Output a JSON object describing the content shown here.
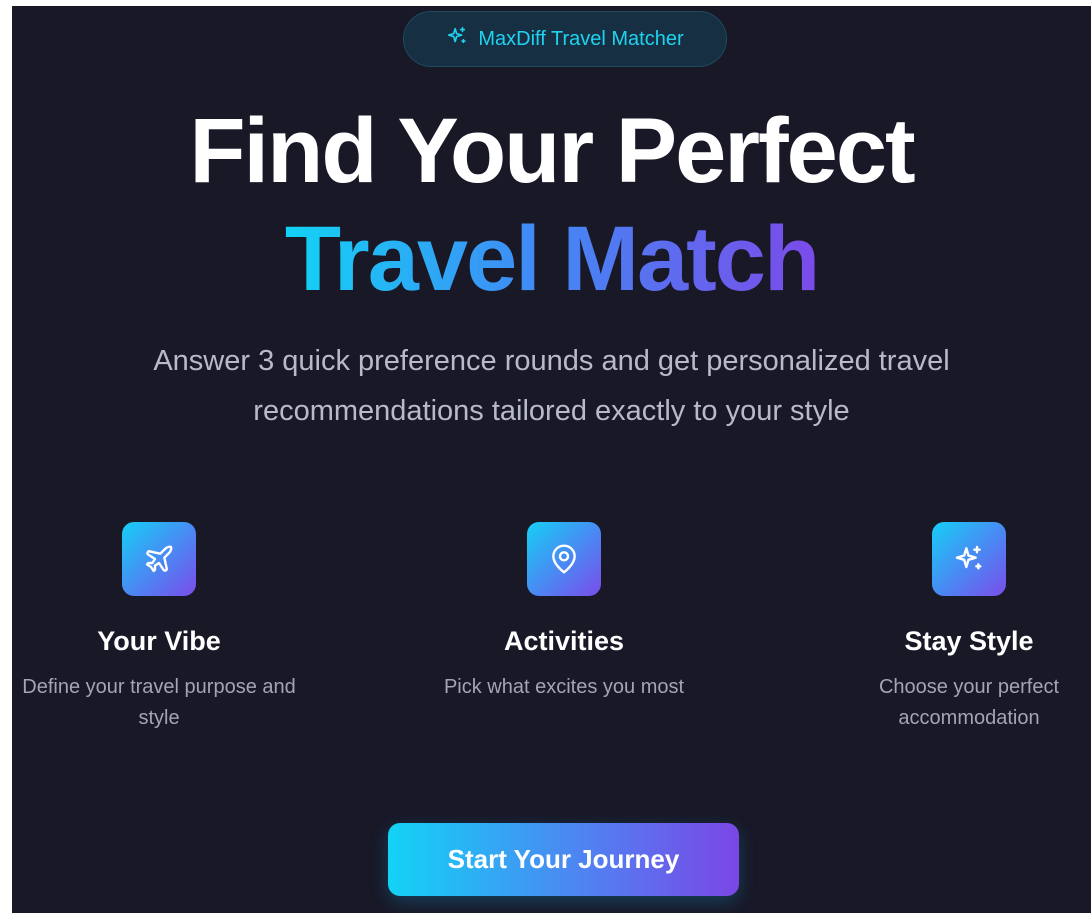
{
  "badge": {
    "icon": "sparkles-icon",
    "label": "MaxDiff Travel Matcher"
  },
  "hero": {
    "title_line1": "Find Your Perfect",
    "title_line2": "Travel Match",
    "subtitle": "Answer 3 quick preference rounds and get personalized travel recommendations tailored exactly to your style"
  },
  "features": [
    {
      "icon": "plane-icon",
      "title": "Your Vibe",
      "description": "Define your travel purpose and style"
    },
    {
      "icon": "map-pin-icon",
      "title": "Activities",
      "description": "Pick what excites you most"
    },
    {
      "icon": "sparkles-icon",
      "title": "Stay Style",
      "description": "Choose your perfect accommodation"
    }
  ],
  "cta": {
    "label": "Start Your Journey"
  },
  "colors": {
    "background": "#181827",
    "accent_cyan": "#12d3f5",
    "accent_blue": "#3f8df5",
    "accent_purple": "#7c4ae9",
    "badge_text": "#1fd3f0"
  }
}
